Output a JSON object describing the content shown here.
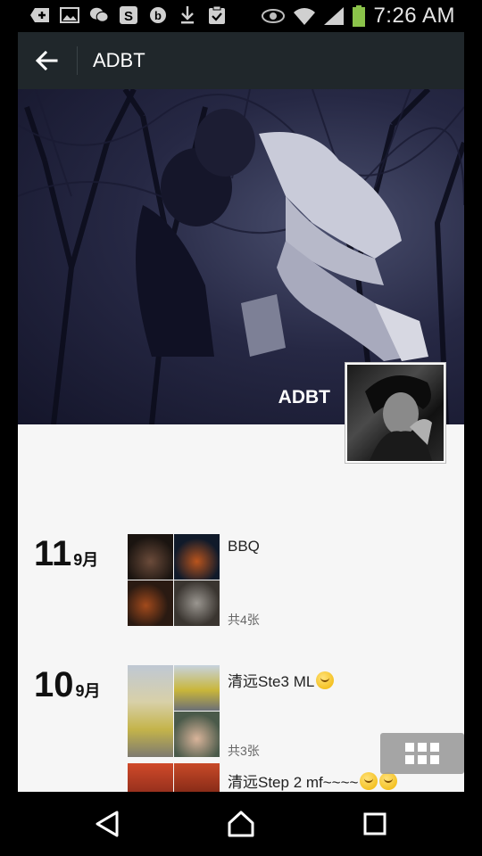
{
  "status_bar": {
    "time": "7:26 AM",
    "left_icons": [
      "add-icon",
      "image-icon",
      "wechat-icon",
      "weibo-icon",
      "b-icon",
      "download-icon",
      "clipboard-check-icon"
    ],
    "right_icons": [
      "eye-icon",
      "wifi-icon",
      "signal-icon",
      "battery-icon"
    ]
  },
  "action_bar": {
    "title": "ADBT",
    "back_icon": "arrow-left-icon"
  },
  "profile": {
    "name": "ADBT"
  },
  "posts": [
    {
      "day": "11",
      "month": "9月",
      "title": "BBQ",
      "count": "共4张",
      "emoji": ""
    },
    {
      "day": "10",
      "month": "9月",
      "title": "清远Ste3 ML",
      "count": "共3张",
      "emoji": "kissing-face"
    },
    {
      "day": "",
      "month": "",
      "title": "清远Step 2 mf~~~~",
      "count": "",
      "emoji": "smiling-face"
    }
  ],
  "nav_bar": {
    "icons": [
      "back-triangle-icon",
      "home-icon",
      "recents-icon"
    ]
  }
}
